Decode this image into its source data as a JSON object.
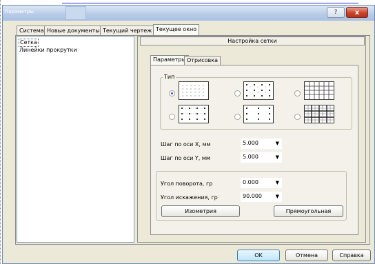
{
  "window": {
    "title": "Параметры"
  },
  "title_buttons": {
    "help": "?",
    "close": "x"
  },
  "tabs": [
    "Система",
    "Новые документы",
    "Текущий чертеж",
    "Текущее окно"
  ],
  "tree": {
    "items": [
      "Сетка",
      "Линейки прокрутки"
    ]
  },
  "section_header": "Настройка сетки",
  "inner_tabs": [
    "Параметры",
    "Отрисовка"
  ],
  "type_group": {
    "legend": "Тип"
  },
  "fields": {
    "step_x_label": "Шаг по оси X, мм",
    "step_x_value": "5.000",
    "step_y_label": "Шаг по оси Y, мм",
    "step_y_value": "5.000",
    "rotation_label": "Угол поворота, гр",
    "rotation_value": "0.000",
    "skew_label": "Угол искажения, гр",
    "skew_value": "90.000"
  },
  "buttons": {
    "isometry": "Изометрия",
    "rectangular": "Прямоугольная",
    "ok": "OK",
    "cancel": "Отмена",
    "help": "Справка"
  }
}
